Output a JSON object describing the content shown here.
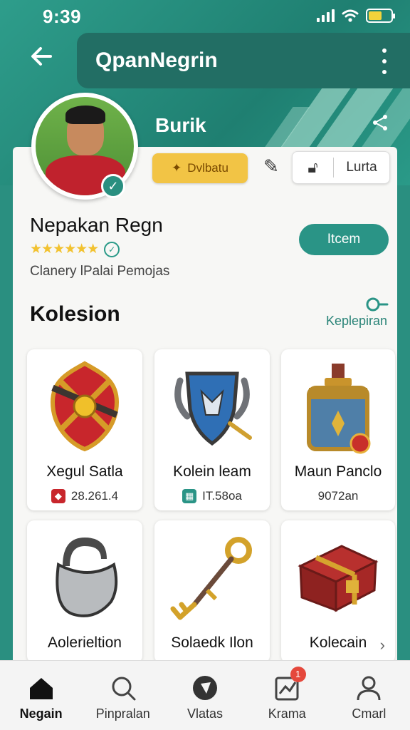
{
  "status_bar": {
    "time": "9:39"
  },
  "app_bar": {
    "title": "QpanNegrin"
  },
  "hero": {
    "label": "Burik"
  },
  "actions": {
    "primary_label": "Dvlbatu",
    "group_label": "Lurta"
  },
  "profile": {
    "name": "Nepakan Regn",
    "stars": "★★★★★★",
    "subtitle": "Clanery lPalai Pemojas",
    "follow_label": "Itcem"
  },
  "section": {
    "title": "Kolesion",
    "link_label": "Keplepiran"
  },
  "items": [
    {
      "name": "Xegul Satla",
      "meta": "28.261.4"
    },
    {
      "name": "Kolein leam",
      "meta": "IT.58oa"
    },
    {
      "name": "Maun Panclo",
      "meta": "9072an"
    },
    {
      "name": "Aolerieltion",
      "meta": ""
    },
    {
      "name": "Solaedk Ilon",
      "meta": ""
    },
    {
      "name": "Kolecain",
      "meta": ""
    }
  ],
  "bottom_nav": [
    {
      "label": "Negain",
      "icon": "home-icon",
      "active": true
    },
    {
      "label": "Pinpralan",
      "icon": "search-icon"
    },
    {
      "label": "Vlatas",
      "icon": "compass-icon"
    },
    {
      "label": "Krama",
      "icon": "chart-icon",
      "badge": "1"
    },
    {
      "label": "Cmarl",
      "icon": "profile-icon"
    }
  ],
  "colors": {
    "primary": "#2a9486",
    "accent": "#f2c445",
    "header_dark": "#226e64"
  }
}
